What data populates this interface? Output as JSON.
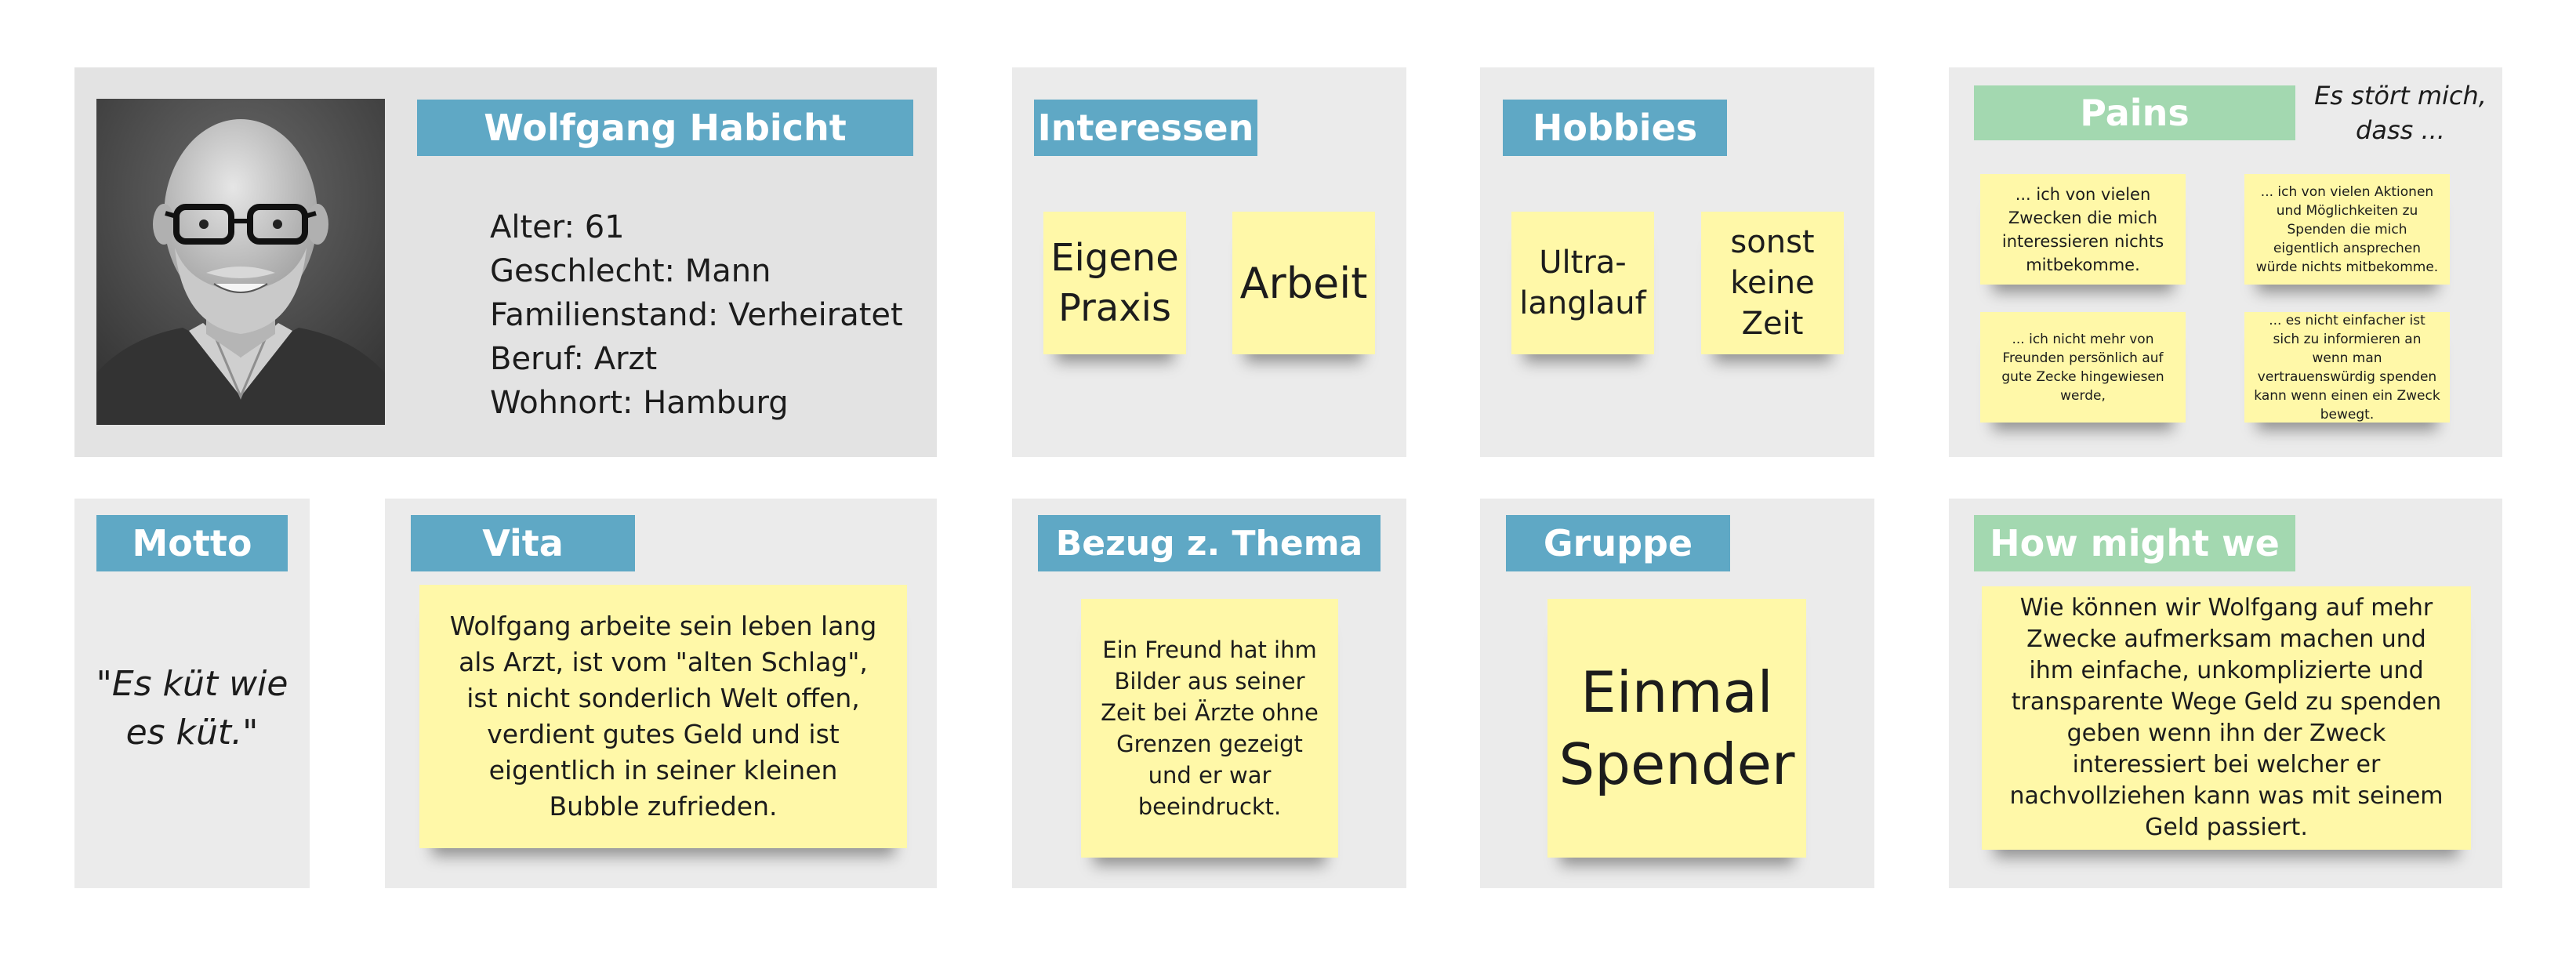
{
  "profile": {
    "name": "Wolfgang Habicht",
    "photo_alt": "Portrait photo of an older bald man with grey beard and black glasses",
    "facts": [
      {
        "label": "Alter",
        "value": "61"
      },
      {
        "label": "Geschlecht",
        "value": "Mann"
      },
      {
        "label": "Familienstand",
        "value": "Verheiratet"
      },
      {
        "label": "Beruf",
        "value": "Arzt"
      },
      {
        "label": "Wohnort",
        "value": "Hamburg"
      }
    ]
  },
  "interessen": {
    "title": "Interessen",
    "notes": [
      "Eigene Praxis",
      "Arbeit"
    ]
  },
  "hobbies": {
    "title": "Hobbies",
    "notes": [
      "Ultra-langlauf",
      "sonst keine Zeit"
    ]
  },
  "pains": {
    "title": "Pains",
    "aside": "Es stört mich, dass ...",
    "notes": [
      "... ich von vielen Zwecken die mich interessieren nichts mitbekomme.",
      "... ich von vielen Aktionen und Möglichkeiten zu Spenden die mich eigentlich ansprechen würde nichts mitbekomme.",
      "... ich nicht mehr von Freunden persönlich auf gute Zecke hingewiesen werde,",
      "... es nicht einfacher ist sich zu informieren an wenn man vertrauenswürdig spenden kann wenn einen ein Zweck bewegt."
    ]
  },
  "motto": {
    "title": "Motto",
    "quote": "\"Es küt wie es küt.\""
  },
  "vita": {
    "title": "Vita",
    "text": "Wolfgang arbeite sein leben lang als Arzt, ist vom \"alten Schlag\", ist nicht sonderlich Welt offen, verdient gutes Geld und ist eigentlich in seiner kleinen Bubble zufrieden."
  },
  "bezug": {
    "title": "Bezug z. Thema",
    "text": "Ein Freund hat ihm Bilder aus seiner Zeit bei Ärzte ohne Grenzen gezeigt und er war beeindruckt."
  },
  "gruppe": {
    "title": "Gruppe",
    "text": "Einmal Spender"
  },
  "hmw": {
    "title": "How might we",
    "text": "Wie können wir Wolfgang auf mehr Zwecke aufmerksam machen und ihm einfache, unkomplizierte und transparente Wege Geld zu spenden geben wenn ihn der Zweck interessiert bei welcher er nachvollziehen kann was mit seinem Geld passiert."
  },
  "colors": {
    "tag_blue": "#5fa8c5",
    "tag_green": "#a3d8b0",
    "sticky_note": "#fff8a8",
    "panel_grey": "#ebebeb"
  }
}
